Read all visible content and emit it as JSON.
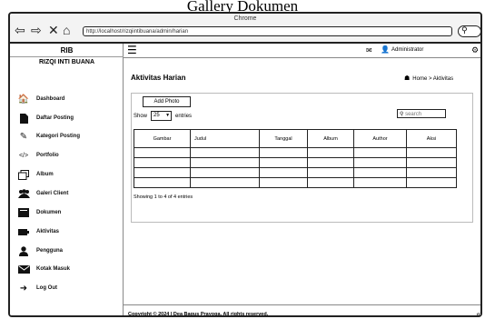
{
  "page": {
    "heading": "Gallery Dokumen"
  },
  "browser": {
    "title": "Chrome",
    "url": "http://localhost/rizqiintibuana/admin/harian",
    "icons": [
      "back-arrow-icon",
      "forward-arrow-icon",
      "close-icon",
      "home-icon",
      "search-icon"
    ]
  },
  "sidebar": {
    "brand": "RIB",
    "org": "RIZQI INTI BUANA",
    "items": [
      {
        "label": "Dashboard",
        "icon": "dashboard-icon"
      },
      {
        "label": "Daftar Posting",
        "icon": "document-icon"
      },
      {
        "label": "Kategori Posting",
        "icon": "pencil-icon"
      },
      {
        "label": "Portfolio",
        "icon": "code-icon"
      },
      {
        "label": "Album",
        "icon": "album-icon"
      },
      {
        "label": "Galeri Client",
        "icon": "users-icon"
      },
      {
        "label": "Dokumen",
        "icon": "folder-icon"
      },
      {
        "label": "Aktivitas",
        "icon": "activity-icon"
      },
      {
        "label": "Pengguna",
        "icon": "user-icon"
      },
      {
        "label": "Kotak Masuk",
        "icon": "mail-icon"
      },
      {
        "label": "Log Out",
        "icon": "logout-icon"
      }
    ]
  },
  "topbar": {
    "user": "Administrator"
  },
  "main": {
    "heading": "Aktivitas Harian",
    "breadcrumb": "Home > Aktivitas",
    "add_button": "Add Photo",
    "show_label": "Show",
    "entries_value": "25",
    "entries_label": "entries",
    "search_placeholder": "search",
    "table": {
      "columns": [
        "Gambar",
        "Judul",
        "Tanggal",
        "Album",
        "Author",
        "Aksi"
      ],
      "rows": [
        [
          "",
          "",
          "",
          "",
          "",
          ""
        ],
        [
          "",
          "",
          "",
          "",
          "",
          ""
        ],
        [
          "",
          "",
          "",
          "",
          "",
          ""
        ],
        [
          "",
          "",
          "",
          "",
          "",
          ""
        ]
      ]
    },
    "showing": "Showing 1 to 4 of 4 entries"
  },
  "footer": {
    "text": "Copyright © 2024 | Dea Bagus Prayoga. All rights reserved."
  }
}
